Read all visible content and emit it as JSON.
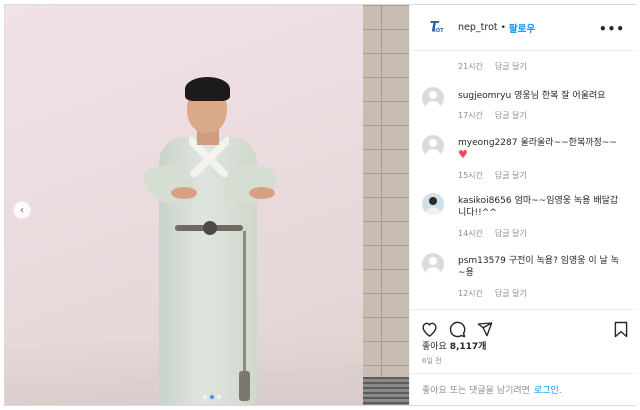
{
  "post": {
    "username": "nep_trot",
    "separator": "•",
    "follow_label": "팔로우",
    "more_label": "•••",
    "logo_text": "T",
    "logo_sub": "ROT"
  },
  "comments_panel": {
    "top_meta": {
      "time": "21시간",
      "reply": "답글 달기"
    },
    "comments": [
      {
        "username": "sugjeomryu",
        "text": "영웅님 한복 잘 어울려요",
        "time": "17시간",
        "reply": "답글 달기",
        "avatar": "default-avatar"
      },
      {
        "username": "myeong2287",
        "text": "울라울라~~한복까정~~",
        "heart": "♥",
        "time": "15시간",
        "reply": "답글 달기",
        "avatar": "default-avatar"
      },
      {
        "username": "kasikoi8656",
        "text": "엄마~~임영웅 녹용 배달갑니다!!^^",
        "time": "14시간",
        "reply": "답글 달기",
        "avatar": "photo-avatar"
      },
      {
        "username": "psm13579",
        "text": "구전이 녹용? 임영웅 이 날 녹~용",
        "time": "12시간",
        "reply": "답글 달기",
        "avatar": "default-avatar"
      }
    ]
  },
  "actions": {
    "likes_label": "좋아요",
    "likes_count": "8,117개",
    "posted_ago": "6일 전"
  },
  "footer": {
    "prompt": "좋아요 또는 댓글을 남기려면",
    "login_label": "로그인."
  },
  "carousel": {
    "prev_glyph": "‹",
    "current_index": 1,
    "total": 3
  },
  "colors": {
    "accent": "#0095f6",
    "heart": "#ed4956",
    "muted": "#8e8e8e",
    "dot_active": "#3897f0"
  }
}
